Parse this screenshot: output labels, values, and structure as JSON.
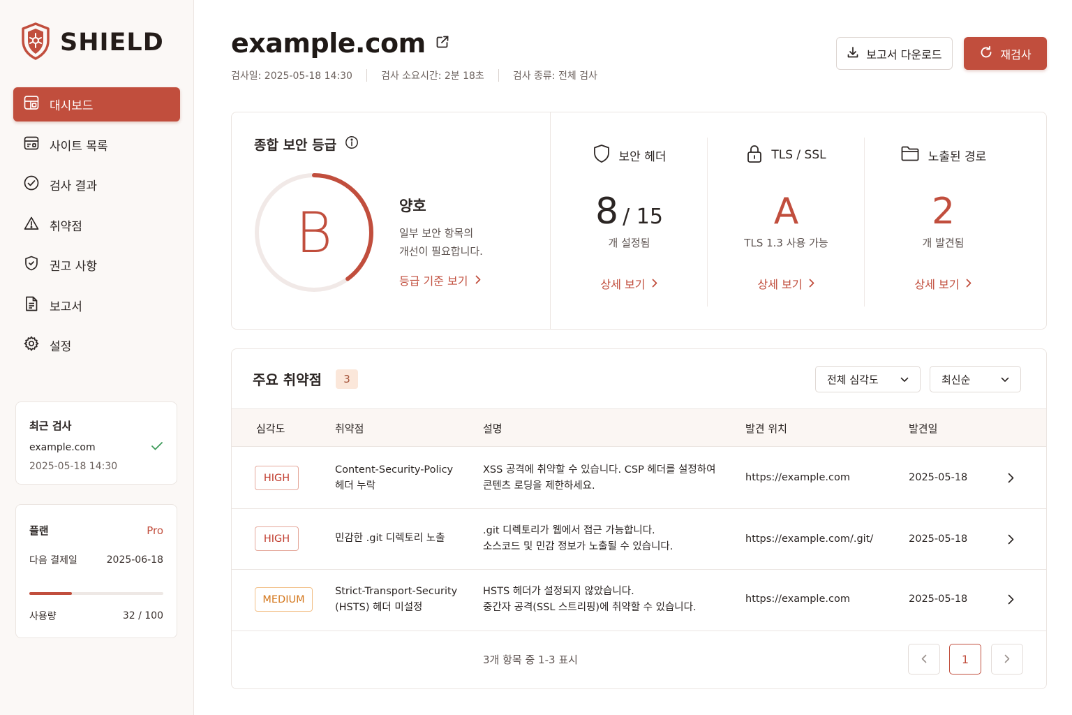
{
  "brand": {
    "name": "SHIELD",
    "accent": "#c14e3d"
  },
  "sidebar": {
    "items": [
      {
        "label": "대시보드",
        "icon": "dashboard-icon",
        "active": true
      },
      {
        "label": "사이트 목록",
        "icon": "site-list-icon",
        "active": false
      },
      {
        "label": "검사 결과",
        "icon": "check-circle-icon",
        "active": false
      },
      {
        "label": "취약점",
        "icon": "warning-icon",
        "active": false
      },
      {
        "label": "권고 사항",
        "icon": "shield-icon",
        "active": false
      },
      {
        "label": "보고서",
        "icon": "document-icon",
        "active": false
      },
      {
        "label": "설정",
        "icon": "gear-icon",
        "active": false
      }
    ],
    "recent": {
      "title": "최근 검사",
      "domain": "example.com",
      "date": "2025-05-18 14:30"
    },
    "plan": {
      "title": "플랜",
      "tier": "Pro",
      "next_billing_label": "다음 결제일",
      "next_billing_value": "2025-06-18",
      "usage_label": "사용량",
      "usage_value": "32 / 100",
      "usage_fraction": 0.32
    }
  },
  "header": {
    "title": "example.com",
    "scan_date": "검사일: 2025-05-18 14:30",
    "scan_duration": "검사 소요시간: 2분 18초",
    "scan_type": "검사 종류: 전체 검사",
    "download_label": "보고서 다운로드",
    "rescan_label": "재검사"
  },
  "grade": {
    "title": "종합 보안 등급",
    "letter": "B",
    "status": "양호",
    "desc_line1": "일부 보안 항목의",
    "desc_line2": "개선이 필요합니다.",
    "link": "등급 기준 보기",
    "ring_fraction": 0.4
  },
  "metrics": [
    {
      "title": "보안 헤더",
      "icon": "shield-icon",
      "value": "8",
      "suffix": "/ 15",
      "sub": "개 설정됨",
      "link": "상세 보기",
      "accent": false
    },
    {
      "title": "TLS / SSL",
      "icon": "lock-icon",
      "value": "A",
      "suffix": "",
      "sub": "TLS 1.3 사용 가능",
      "link": "상세 보기",
      "accent": true
    },
    {
      "title": "노출된 경로",
      "icon": "folder-icon",
      "value": "2",
      "suffix": "",
      "sub": "개 발견됨",
      "link": "상세 보기",
      "accent": true
    }
  ],
  "vulns": {
    "title": "주요 취약점",
    "count": "3",
    "filter_severity": "전체 심각도",
    "filter_sort": "최신순",
    "columns": [
      "심각도",
      "취약점",
      "설명",
      "발견 위치",
      "발견일"
    ],
    "rows": [
      {
        "severity": "HIGH",
        "name1": "Content-Security-Policy",
        "name2": "헤더 누락",
        "desc1": "XSS 공격에 취약할 수 있습니다. CSP 헤더를 설정하여",
        "desc2": "콘텐츠 로딩을 제한하세요.",
        "location": "https://example.com",
        "date": "2025-05-18"
      },
      {
        "severity": "HIGH",
        "name1": "민감한 .git 디렉토리 노출",
        "name2": "",
        "desc1": ".git 디렉토리가 웹에서 접근 가능합니다.",
        "desc2": "소스코드 및 민감 정보가 노출될 수 있습니다.",
        "location": "https://example.com/.git/",
        "date": "2025-05-18"
      },
      {
        "severity": "MEDIUM",
        "name1": "Strict-Transport-Security",
        "name2": "(HSTS) 헤더 미설정",
        "desc1": "HSTS 헤더가 설정되지 않았습니다.",
        "desc2": "중간자 공격(SSL 스트리핑)에 취약할 수 있습니다.",
        "location": "https://example.com",
        "date": "2025-05-18"
      }
    ],
    "footer": "3개 항목 중  1-3 표시",
    "page": "1"
  }
}
